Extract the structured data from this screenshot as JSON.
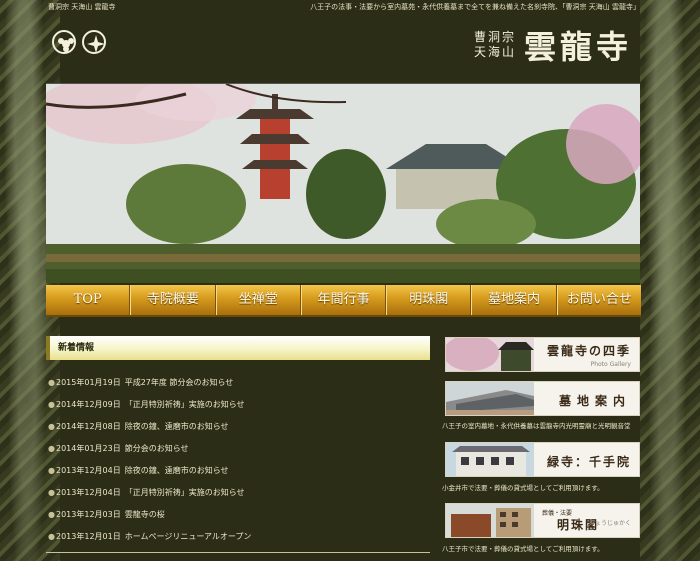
{
  "header": {
    "left_caption": "曹洞宗 天海山 雲龍寺",
    "right_caption": "八王子の法事・法要から室内墓苑・永代供養墓まで全てを兼ね備えた名刹寺院、「曹洞宗 天海山 雲龍寺」",
    "logo_small_line1": "曹洞宗",
    "logo_small_line2": "天海山",
    "logo_main": "雲龍寺"
  },
  "menu": {
    "items": [
      {
        "label": "TOP"
      },
      {
        "label": "寺院概要"
      },
      {
        "label": "坐禅堂"
      },
      {
        "label": "年間行事"
      },
      {
        "label": "明珠閣"
      },
      {
        "label": "墓地案内"
      },
      {
        "label": "お問い合せ"
      }
    ]
  },
  "news": {
    "heading": "新着情報",
    "bullet": "●",
    "items": [
      {
        "date": "2015年01月19日",
        "title": "平成27年度 節分会のお知らせ"
      },
      {
        "date": "2014年12月09日",
        "title": "「正月特別祈祷」実施のお知らせ"
      },
      {
        "date": "2014年12月08日",
        "title": "除夜の鐘、遠磨市のお知らせ"
      },
      {
        "date": "2014年01月23日",
        "title": "節分会のお知らせ"
      },
      {
        "date": "2013年12月04日",
        "title": "除夜の鐘、遠磨市のお知らせ"
      },
      {
        "date": "2013年12月04日",
        "title": "「正月特別祈祷」実施のお知らせ"
      },
      {
        "date": "2013年12月03日",
        "title": "雲龍寺の桜"
      },
      {
        "date": "2013年12月01日",
        "title": "ホームページリニューアルオープン"
      }
    ]
  },
  "banners": {
    "seasons": {
      "title": "雲龍寺の四季",
      "sub": "Photo Gallery"
    },
    "cemetery": {
      "title": "墓地案内",
      "caption": "八王子の室内墓地・永代供養墓は雲龍寺内光明霊廟と光明観音堂"
    },
    "jizo": {
      "title": "緑寺：千手院",
      "caption": "小金井市で法要・葬儀の貸式場としてご利用頂けます。"
    },
    "meishu": {
      "smalltop": "葬儀・法要",
      "title": "明珠閣",
      "sub": "みょうじゅかく",
      "caption": "八王子市で法要・葬儀の貸式場としてご利用頂けます。"
    }
  },
  "colors": {
    "background": "#2b2d16",
    "menu_gold": "#d59a1d",
    "text": "#ece6c8"
  }
}
